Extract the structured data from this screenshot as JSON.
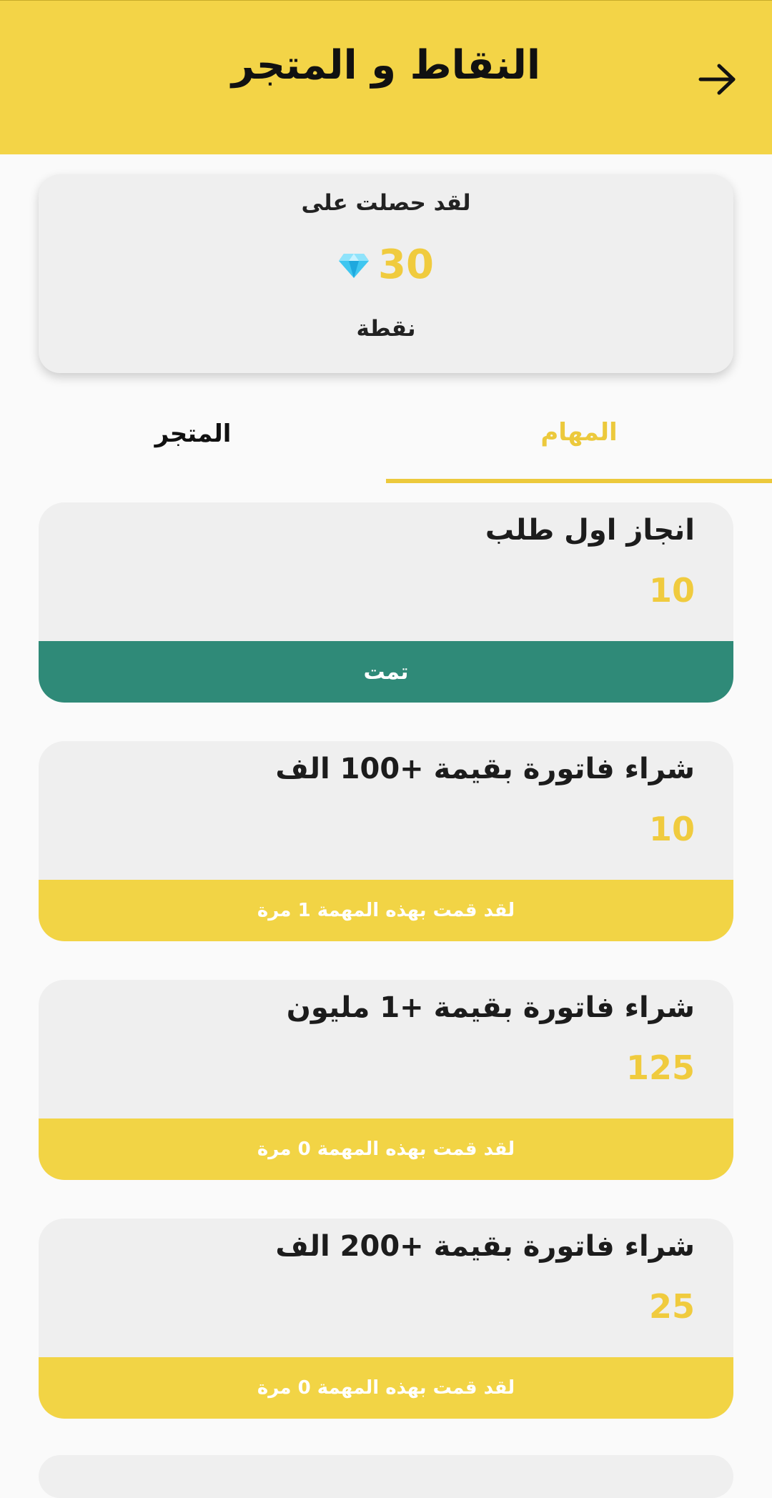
{
  "header": {
    "title": "النقاط و المتجر",
    "back_icon": "arrow-right-icon"
  },
  "points_card": {
    "label": "لقد حصلت على",
    "value": "30",
    "unit": "نقطة",
    "icon": "diamond-icon"
  },
  "tabs": [
    {
      "label": "المهام",
      "active": true
    },
    {
      "label": "المتجر",
      "active": false
    }
  ],
  "tasks": [
    {
      "title": "انجاز اول طلب",
      "points": "10",
      "status": "تمت",
      "done": true
    },
    {
      "title": "شراء فاتورة بقيمة +100 الف",
      "points": "10",
      "status": "لقد قمت بهذه المهمة 1 مرة",
      "done": false
    },
    {
      "title": "شراء فاتورة بقيمة +1 مليون",
      "points": "125",
      "status": "لقد قمت بهذه المهمة 0 مرة",
      "done": false
    },
    {
      "title": "شراء فاتورة بقيمة +200 الف",
      "points": "25",
      "status": "لقد قمت بهذه المهمة 0 مرة",
      "done": false
    }
  ],
  "colors": {
    "accent": "#f3d447",
    "done": "#2f8a78",
    "points": "#f0cb3e"
  }
}
